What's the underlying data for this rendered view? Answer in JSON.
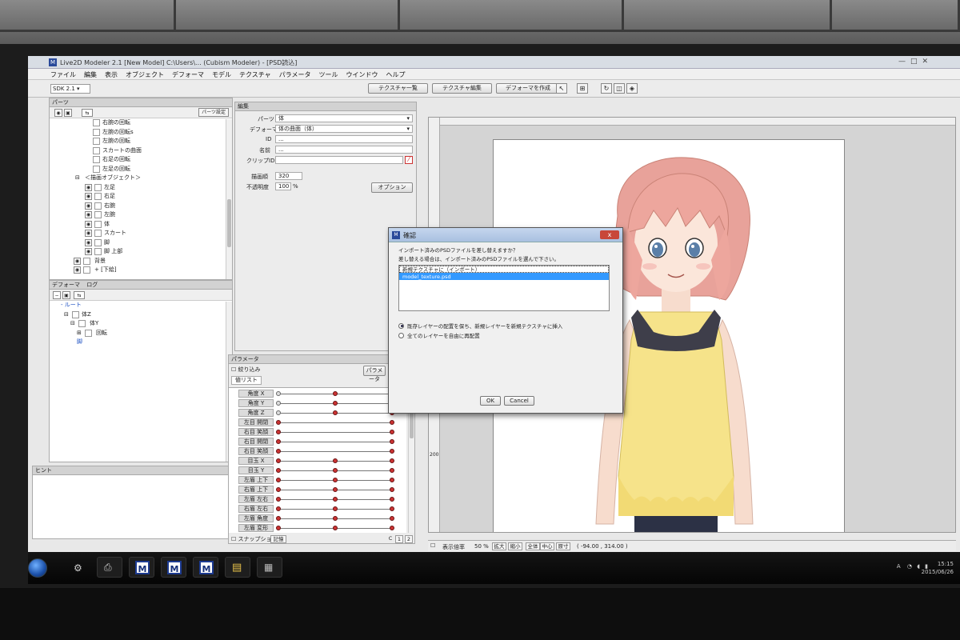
{
  "window": {
    "title": "Live2D Modeler 2.1 [New Model] C:\\Users\\... (Cubism Modeler) - [PSD読込]",
    "minimize": "—",
    "maximize": "□",
    "close": "✕"
  },
  "menubar": [
    "ファイル",
    "編集",
    "表示",
    "オブジェクト",
    "デフォーマ",
    "モデル",
    "テクスチャ",
    "パラメータ",
    "ツール",
    "ウインドウ",
    "ヘルプ"
  ],
  "toolbar": {
    "sdk_select": "SDK 2.1",
    "texture_list": "テクスチャ一覧",
    "texture_edit": "テクスチャ編集",
    "create_deformer": "デフォーマを作成"
  },
  "parts_panel": {
    "title": "パーツ",
    "settings_button": "パーツ設定",
    "items": [
      {
        "label": "右腕の回転"
      },
      {
        "label": "左腕の回転s"
      },
      {
        "label": "左腕の回転"
      },
      {
        "label": "スカートの曲面"
      },
      {
        "label": "右足の回転"
      },
      {
        "label": "左足の回転"
      },
      {
        "label": "＜描画オブジェクト＞"
      },
      {
        "label": "左足"
      },
      {
        "label": "右足"
      },
      {
        "label": "右腕"
      },
      {
        "label": "左腕"
      },
      {
        "label": "体"
      },
      {
        "label": "スカート"
      },
      {
        "label": "脚"
      },
      {
        "label": "脚 上部"
      },
      {
        "label": "背景"
      },
      {
        "label": "+ [下絵]"
      }
    ]
  },
  "deformer_panel": {
    "tab_deformer": "デフォーマ",
    "tab_log": "ログ",
    "items": [
      {
        "label": "- ルート"
      },
      {
        "label": "体Z"
      },
      {
        "label": "体Y"
      },
      {
        "label": "回転"
      },
      {
        "label": "脚"
      }
    ]
  },
  "hint_panel": {
    "title": "ヒント"
  },
  "edit_panel": {
    "title": "編集",
    "part_label": "パーツ",
    "part_value": "体",
    "deformer_label": "デフォーマ",
    "deformer_value": "体の曲面（体）",
    "id_label": "ID",
    "id_value": "...",
    "name_label": "名前",
    "name_value": "...",
    "clip_label": "クリップID",
    "clip_value": "",
    "draw_order_label": "描画順",
    "draw_order_value": "320",
    "opacity_label": "不透明度",
    "opacity_value": "100",
    "opacity_unit": "%",
    "option_button": "オプション"
  },
  "param_panel": {
    "title": "パラメータ",
    "narrow_label": "絞り込み",
    "param_button": "パラメータ",
    "tab_list": "値リスト",
    "rows": [
      {
        "label": "角度 X",
        "keys": [
          0.0,
          0.5,
          1.0
        ]
      },
      {
        "label": "角度 Y",
        "keys": [
          0.0,
          0.5,
          1.0
        ]
      },
      {
        "label": "角度 Z",
        "keys": [
          0.0,
          0.5,
          1.0
        ]
      },
      {
        "label": "左目 開閉",
        "keys": [
          0.0,
          1.0
        ]
      },
      {
        "label": "右目 笑顔",
        "keys": [
          0.0,
          1.0
        ]
      },
      {
        "label": "右目 開閉",
        "keys": [
          0.0,
          1.0
        ]
      },
      {
        "label": "右目 笑顔",
        "keys": [
          0.0,
          1.0
        ]
      },
      {
        "label": "目玉 X",
        "keys": [
          0.0,
          0.5,
          1.0
        ]
      },
      {
        "label": "目玉 Y",
        "keys": [
          0.0,
          0.5,
          1.0
        ]
      },
      {
        "label": "左眉 上下",
        "keys": [
          0.0,
          0.5,
          1.0
        ]
      },
      {
        "label": "右眉 上下",
        "keys": [
          0.0,
          0.5,
          1.0
        ]
      },
      {
        "label": "左眉 左右",
        "keys": [
          0.0,
          0.5,
          1.0
        ]
      },
      {
        "label": "右眉 左右",
        "keys": [
          0.0,
          0.5,
          1.0
        ]
      },
      {
        "label": "左眉 角度",
        "keys": [
          0.0,
          0.5,
          1.0
        ]
      },
      {
        "label": "左眉 変形",
        "keys": [
          0.0,
          0.5,
          1.0
        ]
      }
    ],
    "snapshot_label": "スナップショット",
    "record_button": "記憶",
    "c_button": "C",
    "one_button": "1",
    "two_button": "2"
  },
  "canvas": {
    "ruler_mark": "200",
    "zoom_label": "表示倍率",
    "zoom_value": "50 %",
    "zoom_in": "拡大",
    "zoom_out": "縮小",
    "fit_all": "全体",
    "center": "中心",
    "actual": "原寸",
    "coords": "( -94.00 , 314.00 )"
  },
  "dialog": {
    "title": "確認",
    "close_label": "x",
    "message1": "インポート済みのPSDファイルを差し替えますか？",
    "message2": "差し替える場合は、インポート済みのPSDファイルを選んで下さい。",
    "list_items": [
      {
        "label": "新規テクスチャに（インポート）"
      },
      {
        "label": "model_texture.psd"
      }
    ],
    "radio1": "既存レイヤーの配置を保ち、新規レイヤーを新規テクスチャに挿入",
    "radio2": "全てのレイヤーを自由に再配置",
    "ok_button": "OK",
    "cancel_button": "Cancel"
  },
  "taskbar": {
    "tasks": [
      {
        "icon": "tools-icon"
      },
      {
        "icon": "printer-icon"
      },
      {
        "label": "M"
      },
      {
        "label": "M"
      },
      {
        "label": "M"
      },
      {
        "icon": "folder-icon"
      },
      {
        "icon": "media-icon"
      }
    ],
    "tray_lang": "A",
    "clock_time": "15:15",
    "clock_date": "2015/06/26"
  }
}
